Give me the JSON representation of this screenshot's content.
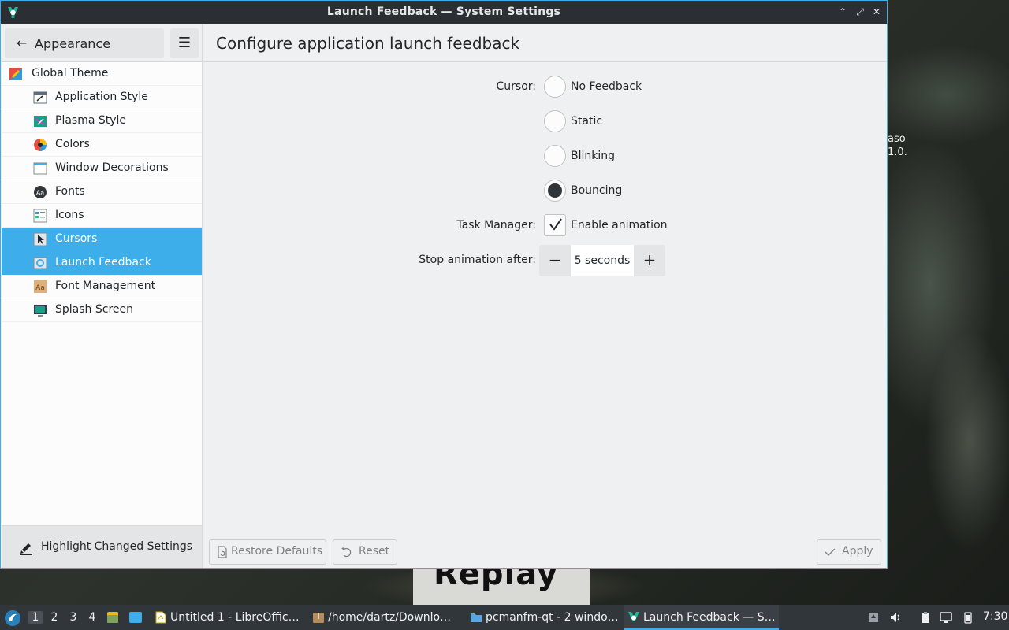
{
  "window": {
    "title": "Launch Feedback  — System Settings",
    "minimize_glyph": "⌃",
    "maximize_glyph": "⤢",
    "close_glyph": "✕"
  },
  "sidebar": {
    "back_label": "Appearance",
    "back_icon": "arrow-left-icon",
    "menu_icon": "hamburger-menu-icon",
    "items": [
      {
        "label": "Global Theme",
        "icon": "global-theme-icon",
        "selected": false
      },
      {
        "label": "Application Style",
        "icon": "application-style-icon",
        "selected": false
      },
      {
        "label": "Plasma Style",
        "icon": "plasma-style-icon",
        "selected": false
      },
      {
        "label": "Colors",
        "icon": "colors-icon",
        "selected": false
      },
      {
        "label": "Window Decorations",
        "icon": "window-decorations-icon",
        "selected": false
      },
      {
        "label": "Fonts",
        "icon": "fonts-icon",
        "selected": false
      },
      {
        "label": "Icons",
        "icon": "icons-icon",
        "selected": false
      },
      {
        "label": "Cursors",
        "icon": "cursors-icon",
        "selected": true
      },
      {
        "label": "Launch Feedback",
        "icon": "launch-feedback-icon",
        "selected": true
      },
      {
        "label": "Font Management",
        "icon": "font-management-icon",
        "selected": false
      },
      {
        "label": "Splash Screen",
        "icon": "splash-screen-icon",
        "selected": false
      }
    ],
    "highlight_label": "Highlight Changed Settings"
  },
  "main": {
    "title": "Configure application launch feedback",
    "cursor_label": "Cursor:",
    "cursor_options": [
      {
        "label": "No Feedback",
        "checked": false
      },
      {
        "label": "Static",
        "checked": false
      },
      {
        "label": "Blinking",
        "checked": false
      },
      {
        "label": "Bouncing",
        "checked": true
      }
    ],
    "task_manager_label": "Task Manager:",
    "enable_animation_label": "Enable animation",
    "enable_animation_checked": true,
    "stop_after_label": "Stop animation after:",
    "stop_after_value": "5 seconds",
    "minus_glyph": "−",
    "plus_glyph": "+"
  },
  "footer": {
    "restore_label": "Restore Defaults",
    "reset_label": "Reset",
    "apply_label": "Apply"
  },
  "desktop": {
    "text_line1": "aso",
    "text_line2": "1.0.",
    "sign_text": "Replay"
  },
  "taskbar": {
    "desktops": [
      "1",
      "2",
      "3",
      "4"
    ],
    "tasks": [
      {
        "label": "Untitled 1 - LibreOffic…",
        "icon": "libreoffice-icon"
      },
      {
        "label": "/home/dartz/Downlo…",
        "icon": "archive-icon"
      },
      {
        "label": "pcmanfm-qt - 2 windo…",
        "icon": "folder-icon"
      },
      {
        "label": "Launch Feedback — S…",
        "icon": "system-settings-icon"
      }
    ],
    "clock": "7:30"
  },
  "colors": {
    "accent": "#3daee9",
    "titlebar": "#2b2f33",
    "panel": "#31363b"
  }
}
